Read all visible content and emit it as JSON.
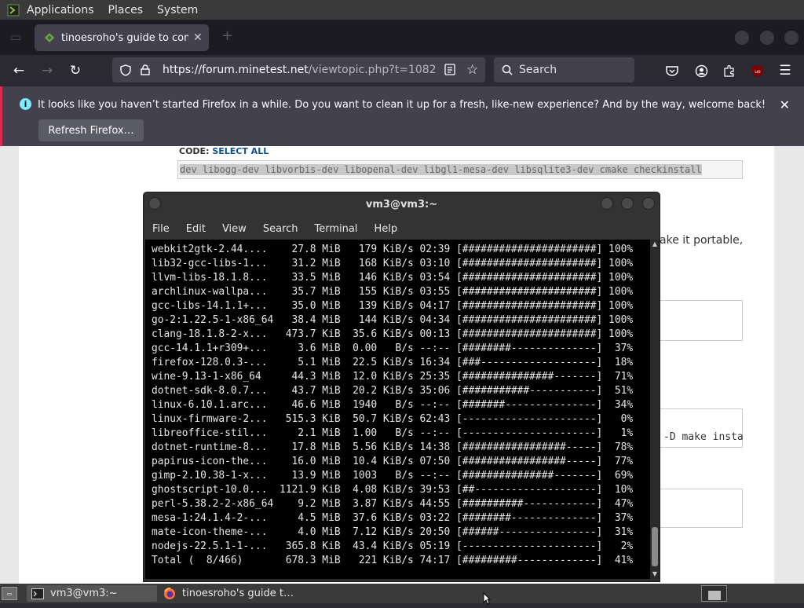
{
  "top_panel": {
    "menus": [
      "Applications",
      "Places",
      "System"
    ]
  },
  "firefox": {
    "tab": {
      "title": "tinoesroho's guide to comp",
      "close": "✕"
    },
    "url": {
      "host": "https://forum.minetest.net",
      "path": "/viewtopic.php?t=1082"
    },
    "search_placeholder": "Search",
    "notification": {
      "message": "It looks like you haven’t started Firefox in a while. Do you want to clean it up for a fresh, like-new experience? And by the way, welcome back!",
      "button": "Refresh Firefox…"
    }
  },
  "webpage": {
    "code_label": "CODE: ",
    "select_all": "SELECT ALL",
    "code_line": "dev libogg-dev libvorbis-dev libopenal-dev libgl1-mesa-dev libsqlite3-dev cmake checkinstall",
    "side_text": "ake it portable,",
    "box_code": "-D make insta"
  },
  "terminal": {
    "title": "vm3@vm3:~",
    "menus": [
      "File",
      "Edit",
      "View",
      "Search",
      "Terminal",
      "Help"
    ],
    "lines": [
      "webkit2gtk-2.44....    27.8 MiB   179 KiB/s 02:39 [######################] 100%",
      "lib32-gcc-libs-1...    31.2 MiB   168 KiB/s 03:10 [######################] 100%",
      "llvm-libs-18.1.8...    33.5 MiB   146 KiB/s 03:54 [######################] 100%",
      "archlinux-wallpa...    35.7 MiB   155 KiB/s 03:55 [######################] 100%",
      "gcc-libs-14.1.1+...    35.0 MiB   139 KiB/s 04:17 [######################] 100%",
      "go-2:1.22.5-1-x86_64   38.4 MiB   144 KiB/s 04:34 [######################] 100%",
      "clang-18.1.8-2-x...   473.7 KiB  35.6 KiB/s 00:13 [######################] 100%",
      "gcc-14.1.1+r309+...     3.6 MiB  0.00   B/s --:-- [########--------------]  37%",
      "firefox-128.0.3-...     5.1 MiB  22.5 KiB/s 16:34 [###-------------------]  18%",
      "wine-9.13-1-x86_64     44.3 MiB  12.0 KiB/s 25:35 [###############-------]  71%",
      "dotnet-sdk-8.0.7...    43.7 MiB  20.2 KiB/s 35:06 [###########-----------]  51%",
      "linux-6.10.1.arc...    46.6 MiB  1940   B/s --:-- [#######---------------]  34%",
      "linux-firmware-2...   515.3 KiB  50.7 KiB/s 62:43 [----------------------]   0%",
      "libreoffice-stil...     2.1 MiB  1.00   B/s --:-- [----------------------]   1%",
      "dotnet-runtime-8...    17.8 MiB  5.56 KiB/s 14:38 [#################-----]  78%",
      "papirus-icon-the...    16.0 MiB  10.4 KiB/s 07:50 [#################-----]  77%",
      "gimp-2.10.38-1-x...    13.9 MiB  1003   B/s --:-- [###############-------]  69%",
      "ghostscript-10.0...  1121.9 KiB  4.08 KiB/s 39:53 [##--------------------]  10%",
      "perl-5.38.2-2-x86_64    9.2 MiB  3.87 KiB/s 44:55 [##########------------]  47%",
      "mesa-1:24.1.4-2-...     4.5 MiB  37.6 KiB/s 03:22 [########--------------]  37%",
      "mate-icon-theme-...     4.0 MiB  7.12 KiB/s 20:50 [######----------------]  31%",
      "nodejs-22.5.1-1-...   365.8 KiB  43.4 KiB/s 05:19 [----------------------]   2%",
      "Total (  8/466)       678.3 MiB   221 KiB/s 74:17 [#########-------------]  41%"
    ]
  },
  "taskbar": {
    "tasks": [
      "vm3@vm3:~",
      "tinoesroho's guide t…"
    ]
  }
}
